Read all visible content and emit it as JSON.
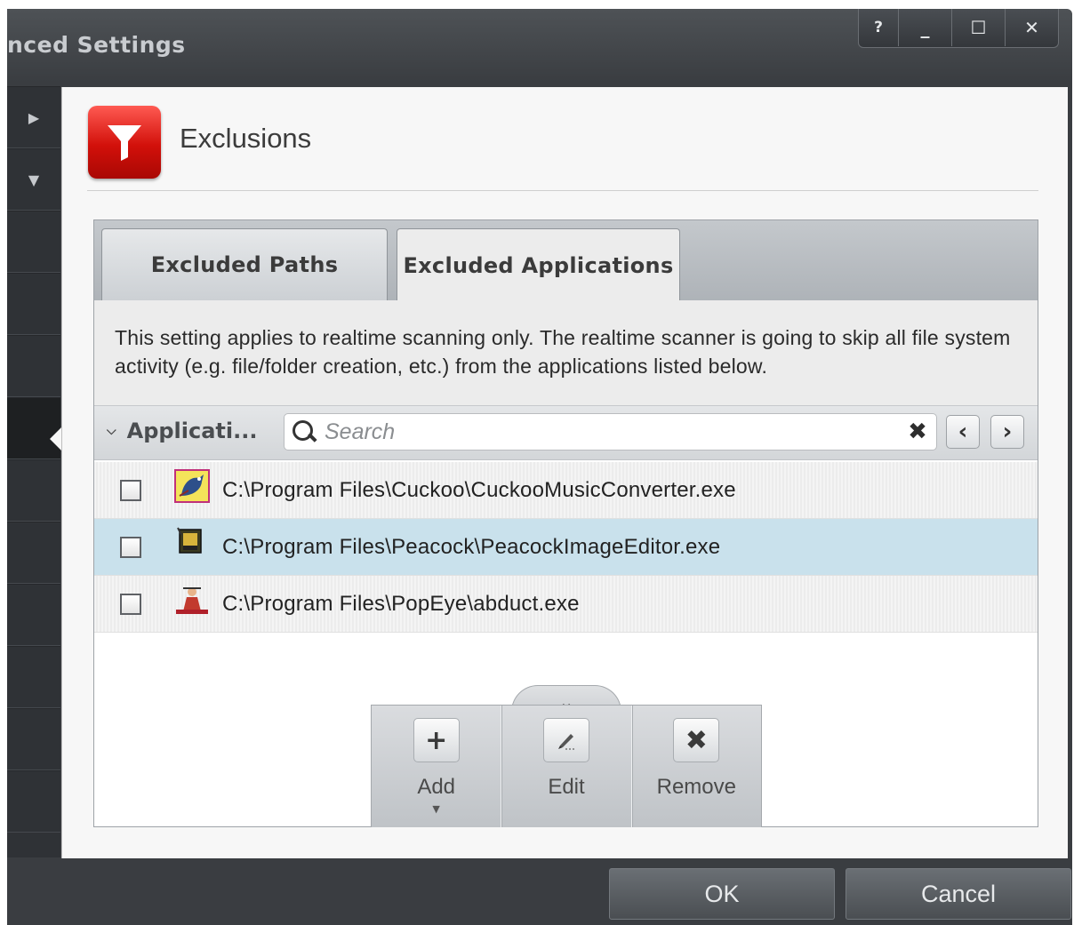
{
  "window": {
    "title": "nced Settings",
    "controls": [
      "?",
      "_",
      "☐",
      "✕"
    ]
  },
  "sidebar": {
    "expand_arrow": "▶",
    "collapse_arrow": "▼"
  },
  "header": {
    "title": "Exclusions",
    "icon": "funnel-icon",
    "accent_color": "#d2100a"
  },
  "tabs": [
    {
      "label": "Excluded Paths",
      "active": false
    },
    {
      "label": "Excluded Applications",
      "active": true
    }
  ],
  "description": "This setting applies to realtime scanning only. The realtime scanner is going to skip all file system activity (e.g. file/folder creation, etc.) from the applications listed below.",
  "filter": {
    "column_label": "Applicati...",
    "search_placeholder": "Search",
    "clear": "✖",
    "prev": "‹",
    "next": "›"
  },
  "applications": [
    {
      "path": "C:\\Program Files\\Cuckoo\\CuckooMusicConverter.exe",
      "checked": false,
      "selected": false,
      "icon": "bird-icon"
    },
    {
      "path": "C:\\Program Files\\Peacock\\PeacockImageEditor.exe",
      "checked": false,
      "selected": true,
      "icon": "image-editor-icon"
    },
    {
      "path": "C:\\Program Files\\PopEye\\abduct.exe",
      "checked": false,
      "selected": false,
      "icon": "figure-icon"
    }
  ],
  "actions": {
    "tray_toggle": "⌄",
    "add": "Add",
    "edit": "Edit",
    "remove": "Remove"
  },
  "footer": {
    "ok": "OK",
    "cancel": "Cancel"
  }
}
